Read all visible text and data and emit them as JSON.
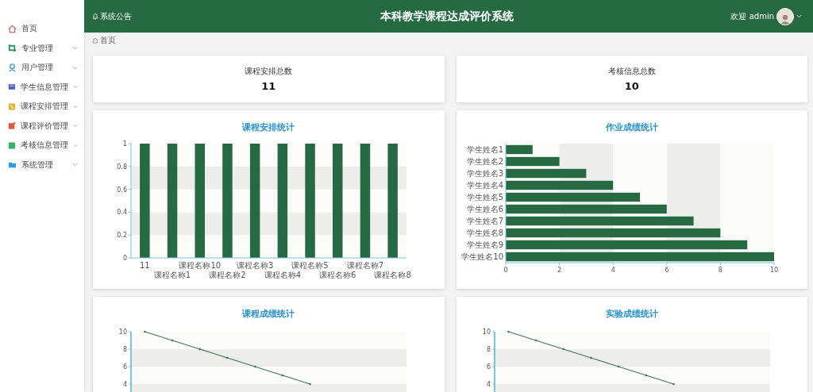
{
  "sidebar": {
    "items": [
      {
        "label": "首页",
        "kind": "link"
      },
      {
        "label": "专业管理",
        "kind": "menu"
      },
      {
        "label": "用户管理",
        "kind": "menu"
      },
      {
        "label": "学生信息管理",
        "kind": "menu"
      },
      {
        "label": "课程安排管理",
        "kind": "menu"
      },
      {
        "label": "课程评价管理",
        "kind": "menu"
      },
      {
        "label": "考核信息管理",
        "kind": "menu"
      },
      {
        "label": "系统管理",
        "kind": "menu"
      }
    ]
  },
  "header": {
    "notice": "系统公告",
    "title": "本科教学课程达成评价系统",
    "welcome": "欢迎 admin"
  },
  "breadcrumb": "首页",
  "stats": [
    {
      "label": "课程安排总数",
      "value": "11"
    },
    {
      "label": "考核信息总数",
      "value": "10"
    }
  ],
  "panels": [
    {
      "title": "课程安排统计",
      "chart_data": {
        "type": "bar",
        "orientation": "vertical",
        "categories": [
          "11",
          "课程名称1",
          "课程名称10",
          "课程名称2",
          "课程名称3",
          "课程名称4",
          "课程名称5",
          "课程名称6",
          "课程名称7",
          "课程名称8"
        ],
        "values": [
          1,
          1,
          1,
          1,
          1,
          1,
          1,
          1,
          1,
          1
        ],
        "ylim": [
          0,
          1
        ],
        "yticks": [
          0,
          0.2,
          0.4,
          0.6,
          0.8,
          1
        ]
      }
    },
    {
      "title": "作业成绩统计",
      "chart_data": {
        "type": "bar",
        "orientation": "horizontal",
        "categories": [
          "学生姓名1",
          "学生姓名2",
          "学生姓名3",
          "学生姓名4",
          "学生姓名5",
          "学生姓名6",
          "学生姓名7",
          "学生姓名8",
          "学生姓名9",
          "学生姓名10"
        ],
        "values": [
          1,
          2,
          3,
          4,
          5,
          6,
          7,
          8,
          9,
          10
        ],
        "xlim": [
          0,
          10
        ],
        "xticks": [
          0,
          2,
          4,
          6,
          8,
          10
        ]
      }
    },
    {
      "title": "课程成绩统计",
      "kind": "line_preview",
      "axis_labels": [
        "10",
        "8",
        "6",
        "4"
      ]
    },
    {
      "title": "实验成绩统计",
      "kind": "line_preview",
      "axis_labels": [
        "10",
        "8",
        "6",
        "4"
      ]
    }
  ]
}
